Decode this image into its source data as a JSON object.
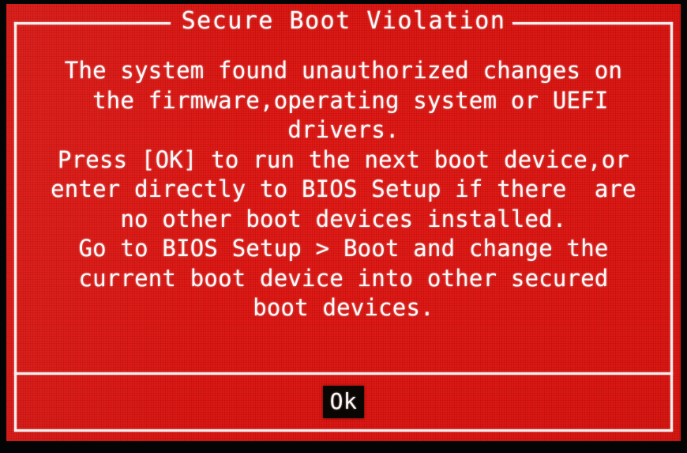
{
  "screen": {
    "background_color": "#d8100c",
    "bezel_color": "#040404",
    "text_color": "#fdf8f8"
  },
  "dialog": {
    "title": "Secure Boot Violation",
    "message_lines": [
      "The system found unauthorized changes on",
      " the firmware,operating system or UEFI",
      "drivers.",
      "Press [OK] to run the next boot device,or",
      "enter directly to BIOS Setup if there  are",
      "no other boot devices installed.",
      "Go to BIOS Setup > Boot and change the",
      "current boot device into other secured",
      "boot devices."
    ],
    "footer": {
      "ok_label": "Ok",
      "ok_button_background": "#0a0604",
      "ok_button_text_color": "#fdf8f8"
    }
  }
}
